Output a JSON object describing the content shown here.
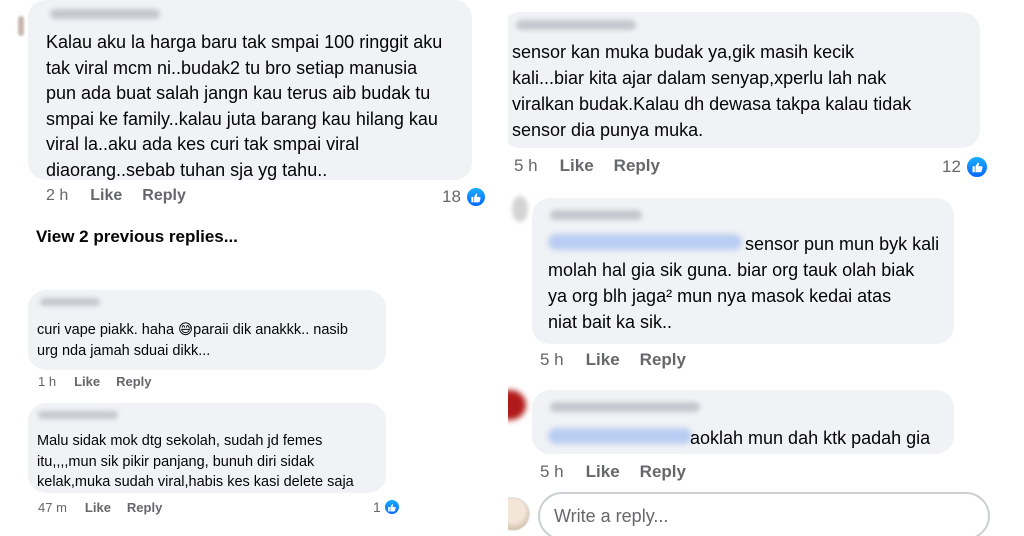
{
  "left": {
    "comments": [
      {
        "text": "Kalau aku la harga baru tak smpai 100 ringgit aku\ntak viral mcm ni..budak2 tu bro setiap manusia\npun ada buat salah jangn kau terus aib budak tu\nsmpai ke family..kalau juta barang kau hilang kau\nviral la..aku ada kes curi tak smpai viral\ndiaorang..sebab tuhan sja yg tahu..",
        "time": "2 h",
        "like": "Like",
        "reply": "Reply",
        "reactions": "18"
      },
      {
        "text": "curi vape piakk. haha 😅paraii dik anakkk.. nasib\nurg nda jamah sduai dikk...",
        "time": "1 h",
        "like": "Like",
        "reply": "Reply"
      },
      {
        "text": "Malu sidak mok dtg sekolah, sudah jd femes\nitu,,,,mun sik pikir panjang, bunuh diri sidak\nkelak,muka sudah viral,habis kes kasi delete saja",
        "time": "47 m",
        "like": "Like",
        "reply": "Reply",
        "reactions": "1"
      }
    ],
    "view_previous": "View 2 previous replies..."
  },
  "right": {
    "comments": [
      {
        "text": "sensor kan muka budak ya,gik masih kecik\nkali...biar kita ajar dalam senyap,xperlu lah nak\nviralkan budak.Kalau dh dewasa takpa kalau tidak\nsensor dia punya muka.",
        "time": "5 h",
        "like": "Like",
        "reply": "Reply",
        "reactions": "12"
      },
      {
        "first_line": "sensor pun mun byk kali",
        "text": "molah hal gia sik guna. biar org tauk olah biak\nya org blh jaga² mun nya masok kedai atas\nniat bait ka sik..",
        "time": "5 h",
        "like": "Like",
        "reply": "Reply"
      },
      {
        "text": "aoklah mun dah ktk padah gia",
        "time": "5 h",
        "like": "Like",
        "reply": "Reply"
      }
    ],
    "reply_placeholder": "Write a reply..."
  },
  "colors": {
    "bubble": "#f0f2f5",
    "meta_text": "#65676b",
    "like_blue": "#0866ff"
  }
}
